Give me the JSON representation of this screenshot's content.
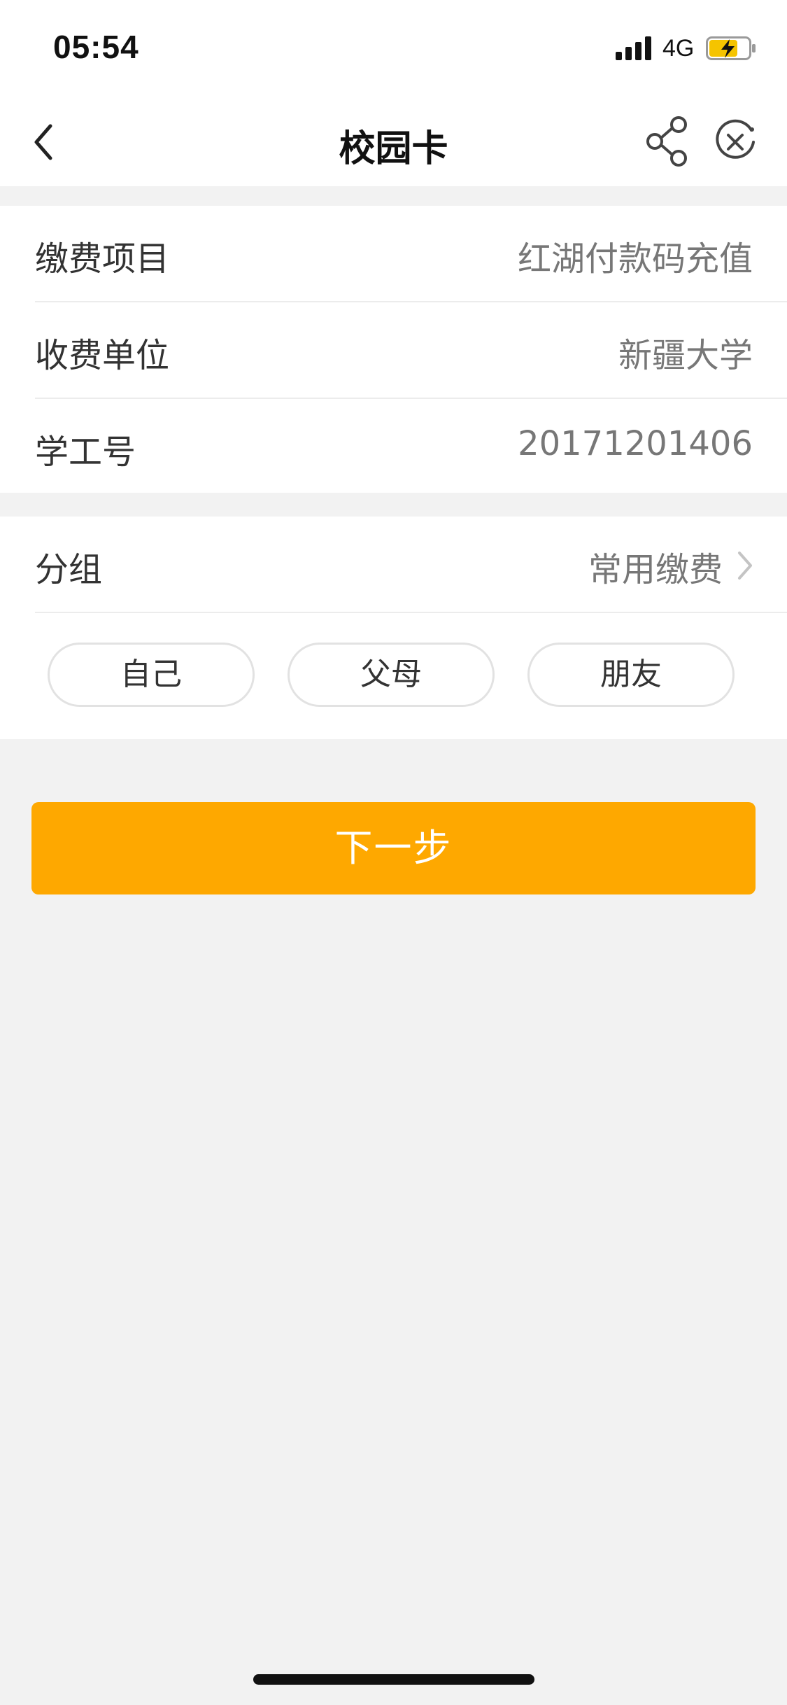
{
  "status_bar": {
    "time": "05:54",
    "network": "4G",
    "icons": [
      "signal-icon",
      "battery-charging-icon"
    ]
  },
  "navbar": {
    "title": "校园卡",
    "icons": [
      "back-chevron-icon",
      "share-icon",
      "close-circle-icon"
    ]
  },
  "payment_info": {
    "rows": [
      {
        "label": "缴费项目",
        "value": "红湖付款码充值"
      },
      {
        "label": "收费单位",
        "value": "新疆大学"
      },
      {
        "label": "学工号",
        "value": "20171201406"
      }
    ]
  },
  "group": {
    "label": "分组",
    "value": "常用缴费",
    "chips": [
      "自己",
      "父母",
      "朋友"
    ]
  },
  "actions": {
    "next_label": "下一步"
  },
  "colors": {
    "accent": "#fea800",
    "background": "#f2f2f2",
    "battery_fill": "#f5c400"
  }
}
